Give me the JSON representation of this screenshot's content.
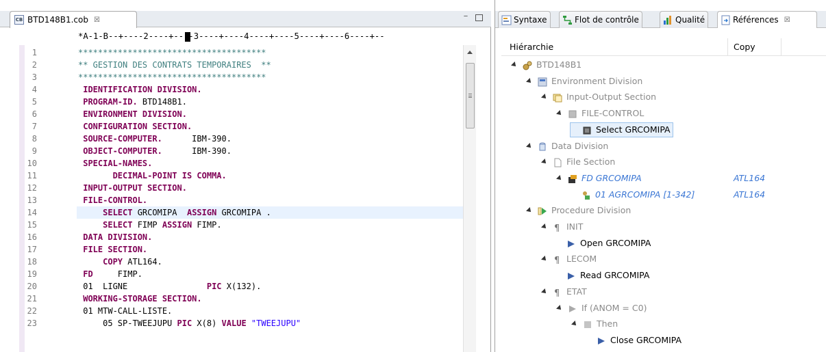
{
  "editor": {
    "tab_title": "BTD148B1.cob",
    "tab_close": "☒",
    "tab_icon_letter": "CB",
    "minimize_glyph": "−",
    "ruler": "*A-1-B--+----2----+----3----+----4----+----5----+----6----+--",
    "line_numbers": [
      "1",
      "2",
      "3",
      "4",
      "5",
      "6",
      "7",
      "8",
      "9",
      "10",
      "11",
      "12",
      "13",
      "14",
      "15",
      "16",
      "17",
      "18",
      "19",
      "20",
      "21",
      "22",
      "23"
    ],
    "lines": [
      [
        {
          "t": "**************************************",
          "k": "comment"
        }
      ],
      [
        {
          "t": "** GESTION DES CONTRATS TEMPORAIRES  **",
          "k": "comment"
        }
      ],
      [
        {
          "t": "**************************************",
          "k": "comment"
        }
      ],
      [
        {
          "t": " IDENTIFICATION DIVISION.",
          "k": "kw"
        }
      ],
      [
        {
          "t": " PROGRAM-ID.",
          "k": "kw"
        },
        {
          "t": " BTD148B1.",
          "k": "plain"
        }
      ],
      [
        {
          "t": " ENVIRONMENT DIVISION.",
          "k": "kw"
        }
      ],
      [
        {
          "t": " CONFIGURATION SECTION.",
          "k": "kw"
        }
      ],
      [
        {
          "t": " SOURCE-COMPUTER.",
          "k": "kw"
        },
        {
          "t": "      IBM-390.",
          "k": "plain"
        }
      ],
      [
        {
          "t": " OBJECT-COMPUTER.",
          "k": "kw"
        },
        {
          "t": "      IBM-390.",
          "k": "plain"
        }
      ],
      [
        {
          "t": " SPECIAL-NAMES.",
          "k": "kw"
        }
      ],
      [
        {
          "t": "       DECIMAL-POINT IS COMMA.",
          "k": "kw"
        }
      ],
      [
        {
          "t": " INPUT-OUTPUT SECTION.",
          "k": "kw"
        }
      ],
      [
        {
          "t": " FILE-CONTROL.",
          "k": "kw"
        }
      ],
      [
        {
          "t": "     SELECT",
          "k": "kw"
        },
        {
          "t": " GRCOMIPA  ",
          "k": "plain"
        },
        {
          "t": "ASSIGN",
          "k": "kw"
        },
        {
          "t": " GRCOMIPA .",
          "k": "plain"
        }
      ],
      [
        {
          "t": "     SELECT",
          "k": "kw"
        },
        {
          "t": " FIMP ",
          "k": "plain"
        },
        {
          "t": "ASSIGN",
          "k": "kw"
        },
        {
          "t": " FIMP.",
          "k": "plain"
        }
      ],
      [
        {
          "t": " DATA DIVISION.",
          "k": "kw"
        }
      ],
      [
        {
          "t": " FILE SECTION.",
          "k": "kw"
        }
      ],
      [
        {
          "t": "     COPY",
          "k": "kw"
        },
        {
          "t": " ATL164.",
          "k": "plain"
        }
      ],
      [
        {
          "t": " FD",
          "k": "kw"
        },
        {
          "t": "     FIMP.",
          "k": "plain"
        }
      ],
      [
        {
          "t": " 01  LIGNE                ",
          "k": "plain"
        },
        {
          "t": "PIC",
          "k": "kw"
        },
        {
          "t": " X(132).",
          "k": "plain"
        }
      ],
      [
        {
          "t": " WORKING-STORAGE SECTION.",
          "k": "kw"
        }
      ],
      [
        {
          "t": " 01 MTW-CALL-LISTE.",
          "k": "plain"
        }
      ],
      [
        {
          "t": "     05 SP-TWEEJUPU ",
          "k": "plain"
        },
        {
          "t": "PIC",
          "k": "kw"
        },
        {
          "t": " X(8) ",
          "k": "plain"
        },
        {
          "t": "VALUE",
          "k": "kw"
        },
        {
          "t": " \"TWEEJUPU\"",
          "k": "str"
        }
      ]
    ]
  },
  "views": {
    "tabs": [
      {
        "label": "Syntaxe",
        "icon": "syntax-icon"
      },
      {
        "label": "Flot de contrôle",
        "icon": "control-flow-icon"
      },
      {
        "label": "Qualité",
        "icon": "quality-bars-icon"
      },
      {
        "label": "Références",
        "icon": "references-icon",
        "close": "☒"
      }
    ],
    "header": {
      "hierarchy": "Hiérarchie",
      "copy": "Copy"
    },
    "tree": [
      {
        "label": "BTD148B1",
        "level": 0,
        "style": "grey",
        "expanded": true,
        "icon": "program-icon"
      },
      {
        "label": "Environment Division",
        "level": 1,
        "style": "grey",
        "expanded": true,
        "icon": "environment-division-icon"
      },
      {
        "label": "Input-Output Section",
        "level": 2,
        "style": "grey",
        "expanded": true,
        "icon": "section-icon"
      },
      {
        "label": "FILE-CONTROL",
        "level": 3,
        "style": "grey",
        "expanded": true,
        "icon": "paragraph-square-icon"
      },
      {
        "label": "Select GRCOMIPA",
        "level": 4,
        "style": "selected",
        "expanded": false,
        "icon": "statement-square-icon"
      },
      {
        "label": "Data Division",
        "level": 1,
        "style": "grey",
        "expanded": true,
        "icon": "data-division-icon"
      },
      {
        "label": "File Section",
        "level": 2,
        "style": "grey",
        "expanded": true,
        "icon": "file-section-icon"
      },
      {
        "label": "FD GRCOMIPA",
        "level": 3,
        "style": "blue",
        "expanded": true,
        "icon": "fd-icon",
        "copy": "ATL164"
      },
      {
        "label": "01 AGRCOMIPA  [1-342]",
        "level": 4,
        "style": "blue",
        "expanded": false,
        "icon": "record-icon",
        "copy": "ATL164"
      },
      {
        "label": "Procedure Division",
        "level": 1,
        "style": "grey",
        "expanded": true,
        "icon": "procedure-division-icon"
      },
      {
        "label": "INIT",
        "level": 2,
        "style": "grey",
        "expanded": true,
        "icon": "pilcrow-icon"
      },
      {
        "label": "Open GRCOMIPA",
        "level": 3,
        "style": "black",
        "expanded": false,
        "icon": "play-triangle-icon"
      },
      {
        "label": "LECOM",
        "level": 2,
        "style": "grey",
        "expanded": true,
        "icon": "pilcrow-icon"
      },
      {
        "label": "Read GRCOMIPA",
        "level": 3,
        "style": "black",
        "expanded": false,
        "icon": "play-triangle-icon"
      },
      {
        "label": "ETAT",
        "level": 2,
        "style": "grey",
        "expanded": true,
        "icon": "pilcrow-icon"
      },
      {
        "label": "If (ANOM = C0)",
        "level": 3,
        "style": "grey",
        "expanded": true,
        "icon": "grey-triangle-icon"
      },
      {
        "label": "Then",
        "level": 4,
        "style": "grey",
        "expanded": true,
        "icon": "grey-square-icon"
      },
      {
        "label": "Close GRCOMIPA",
        "level": 5,
        "style": "black",
        "expanded": false,
        "icon": "play-triangle-icon"
      }
    ]
  },
  "colors": {
    "comment": "#3f7f7f",
    "keyword": "#7f0055",
    "string": "#2a00ff",
    "link": "#3a76d4",
    "highlight": "#e8f2fe"
  }
}
